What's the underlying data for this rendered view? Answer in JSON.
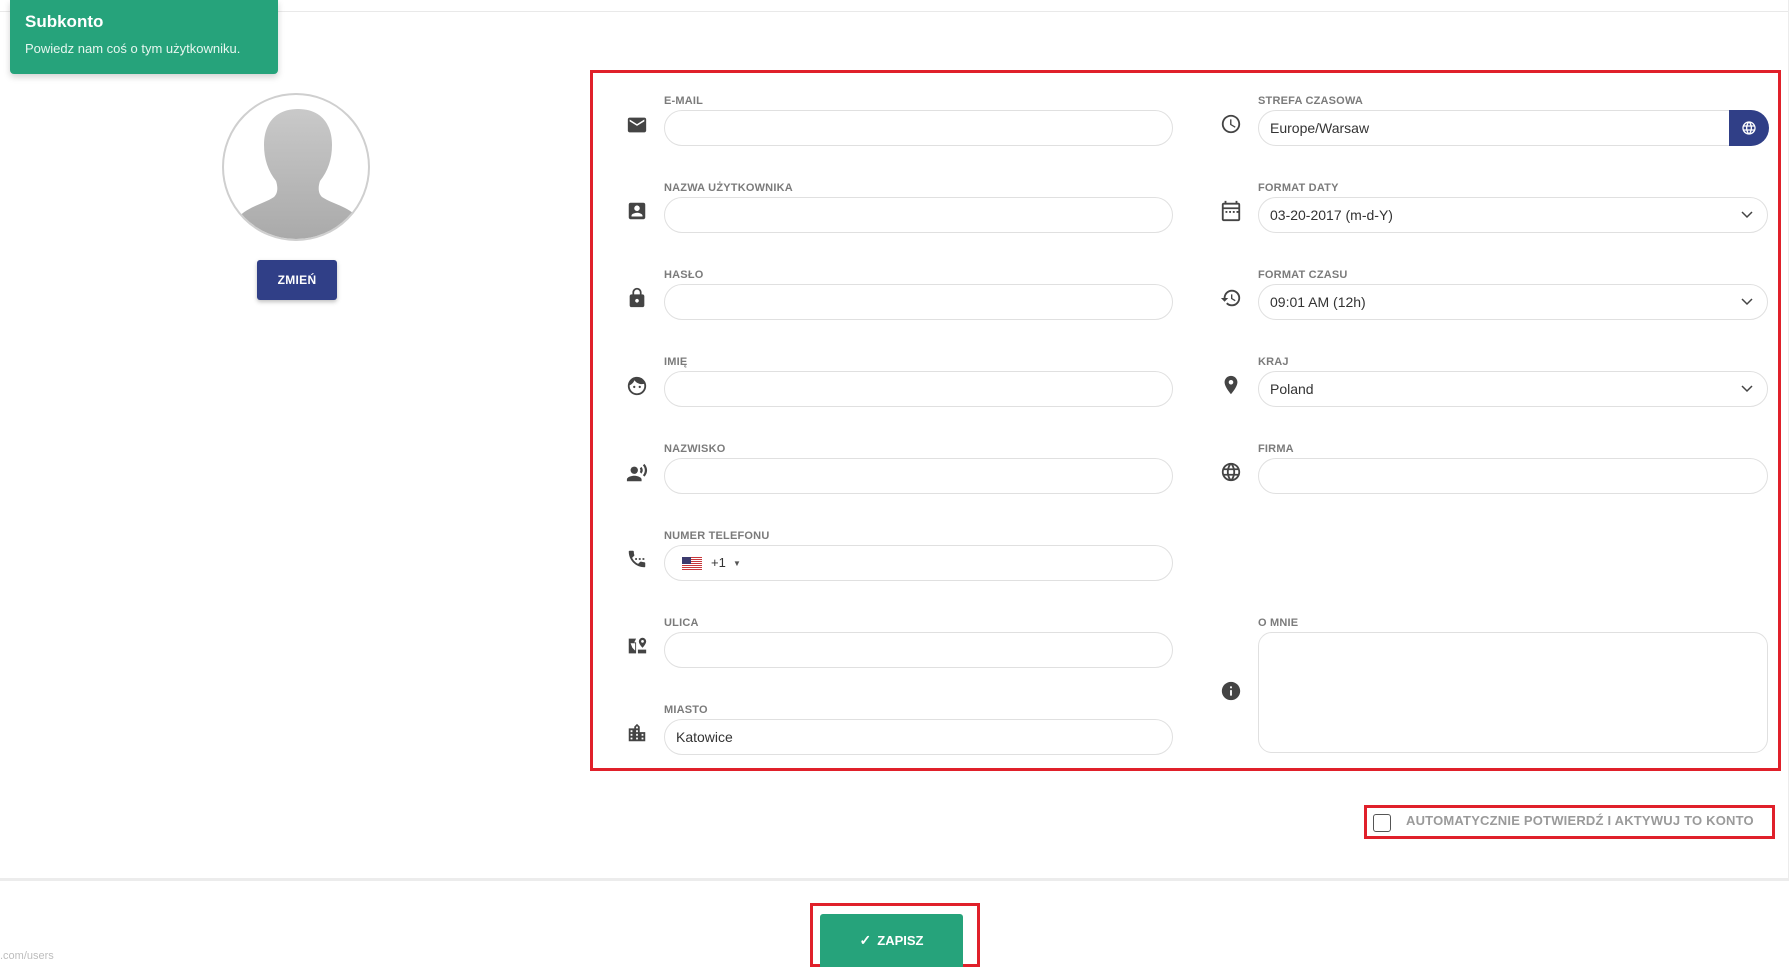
{
  "header": {
    "title": "Subkonto",
    "subtitle": "Powiedz nam coś o tym użytkowniku."
  },
  "avatar": {
    "change_label": "ZMIEŃ"
  },
  "left_fields": [
    {
      "label": "E-MAIL",
      "value": "",
      "icon": "envelope-icon"
    },
    {
      "label": "NAZWA UŻYTKOWNIKA",
      "value": "",
      "icon": "contact-card-icon"
    },
    {
      "label": "HASŁO",
      "value": "",
      "icon": "lock-icon"
    },
    {
      "label": "IMIĘ",
      "value": "",
      "icon": "face-icon"
    },
    {
      "label": "NAZWISKO",
      "value": "",
      "icon": "person-voice-icon"
    },
    {
      "label": "NUMER TELEFONU",
      "value": "",
      "icon": "phone-icon",
      "country_code": "+1",
      "flag": "us-flag-icon"
    },
    {
      "label": "ULICA",
      "value": "",
      "icon": "map-place-icon"
    },
    {
      "label": "MIASTO",
      "value": "Katowice",
      "icon": "city-icon"
    }
  ],
  "right_fields": [
    {
      "label": "STREFA CZASOWA",
      "value": "Europe/Warsaw",
      "icon": "clock-icon"
    },
    {
      "label": "FORMAT DATY",
      "value": "03-20-2017 (m-d-Y)",
      "icon": "calendar-icon"
    },
    {
      "label": "FORMAT CZASU",
      "value": "09:01 AM (12h)",
      "icon": "history-icon"
    },
    {
      "label": "KRAJ",
      "value": "Poland",
      "icon": "location-pin-icon"
    },
    {
      "label": "FIRMA",
      "value": "",
      "icon": "globe-icon"
    },
    {
      "label": "O MNIE",
      "value": "",
      "icon": "info-icon"
    }
  ],
  "auto_confirm": {
    "label": "AUTOMATYCZNIE POTWIERDŹ I AKTYWUJ TO KONTO",
    "checked": false
  },
  "save": {
    "label": "ZAPISZ"
  },
  "footer": {
    "url_hint": ".com/users"
  },
  "colors": {
    "green": "#26a37b",
    "navy": "#303f87",
    "highlight_red": "#e0202a"
  }
}
